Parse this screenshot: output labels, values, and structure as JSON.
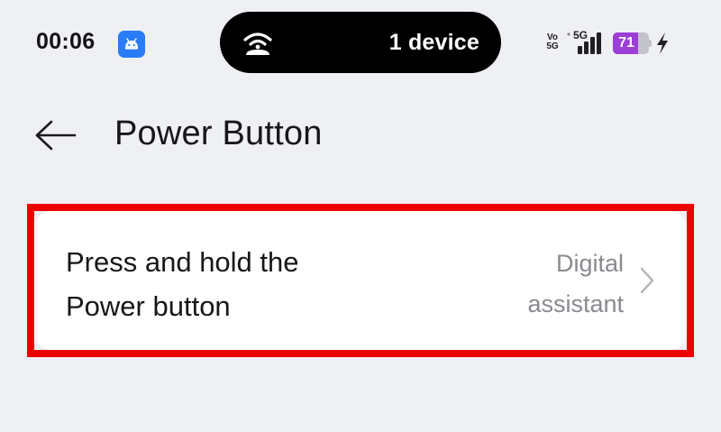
{
  "status_bar": {
    "time": "00:06",
    "notification_icon": "android-robot-icon",
    "island": {
      "icon": "hotspot-icon",
      "text": "1 device"
    },
    "volte_top": "Vo",
    "volte_bottom": "5G",
    "network_type": "5G",
    "signal_icon": "signal-bars-icon",
    "battery_level": "71",
    "battery_fraction": 0.71,
    "charging_icon": "lightning-bolt-icon",
    "battery_color": "#9b3fd6"
  },
  "header": {
    "back_icon": "back-arrow-icon",
    "title": "Power Button"
  },
  "setting": {
    "title_line1": "Press and hold the",
    "title_line2": "Power button",
    "value_line1": "Digital",
    "value_line2": "assistant",
    "chevron_icon": "chevron-right-icon",
    "highlight_color": "#ee0000"
  }
}
